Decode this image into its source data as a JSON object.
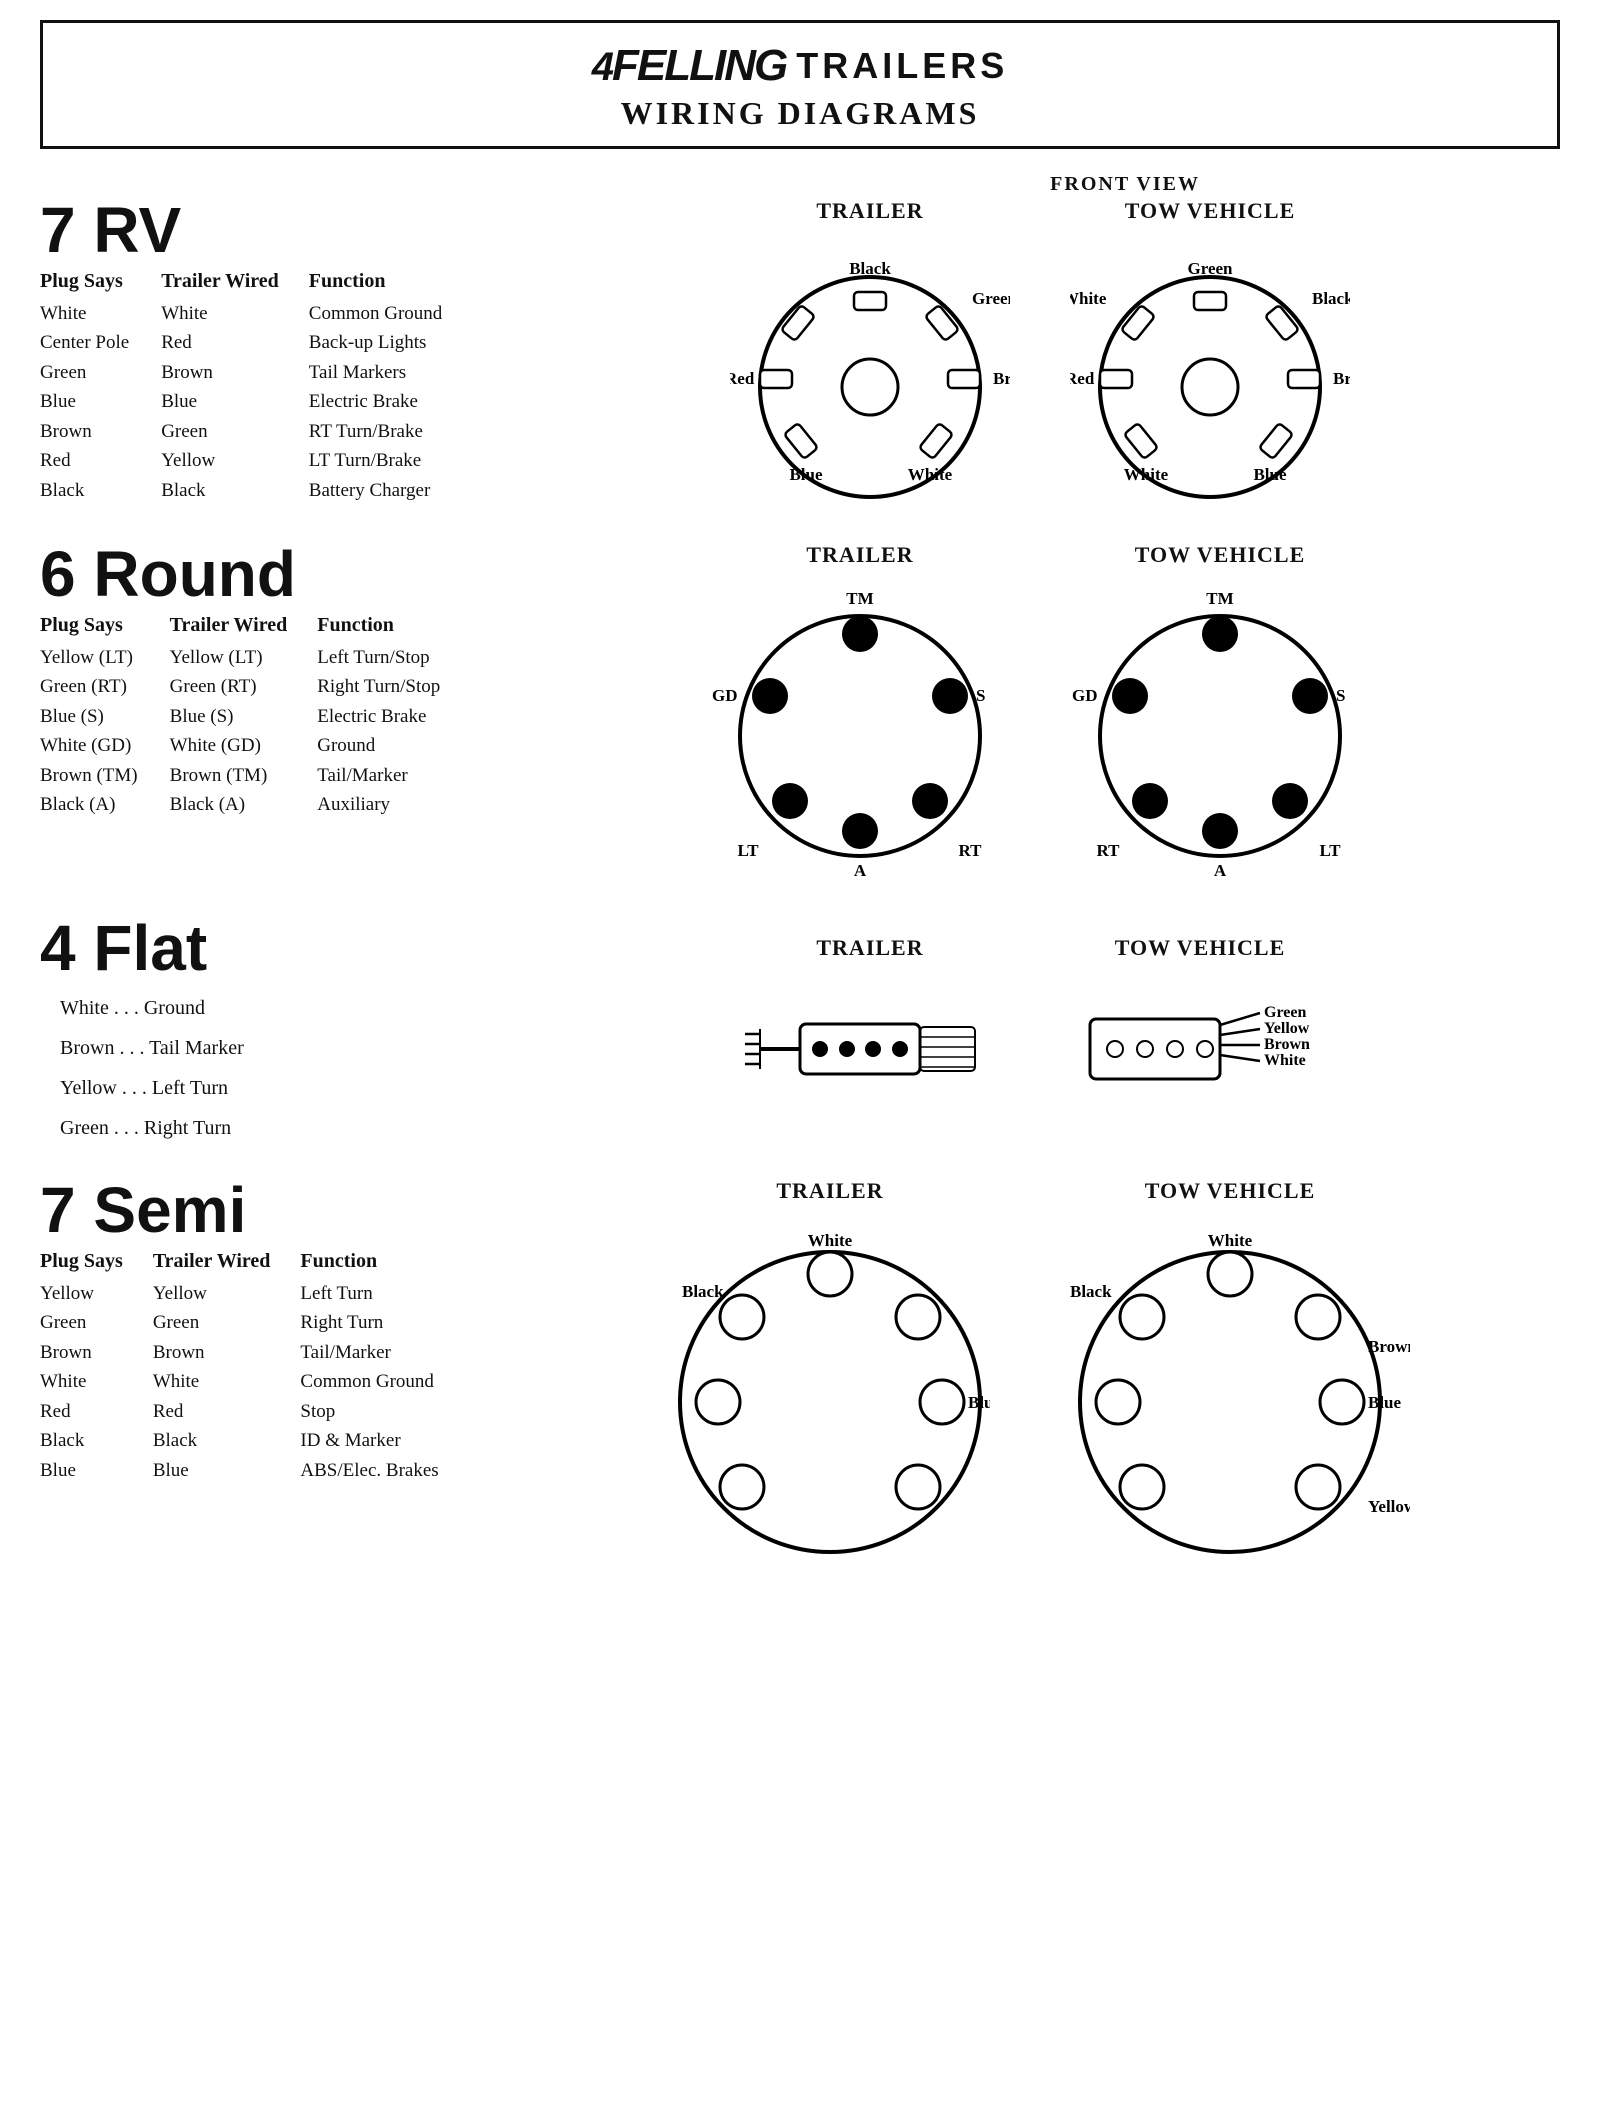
{
  "header": {
    "brand": "FELLING",
    "title_line1": "TRAILERS",
    "title_line2": "WIRING DIAGRAMS"
  },
  "front_view_label": "FRONT VIEW",
  "sections": {
    "rv7": {
      "title": "7 RV",
      "col1": "Plug Says",
      "col2": "Trailer Wired",
      "col3": "Function",
      "rows": [
        [
          "White",
          "White",
          "Common Ground"
        ],
        [
          "Center Pole",
          "Red",
          "Back-up Lights"
        ],
        [
          "Green",
          "Brown",
          "Tail Markers"
        ],
        [
          "Blue",
          "Blue",
          "Electric Brake"
        ],
        [
          "Brown",
          "Green",
          "RT Turn/Brake"
        ],
        [
          "Red",
          "Yellow",
          "LT Turn/Brake"
        ],
        [
          "Black",
          "Black",
          "Battery Charger"
        ]
      ],
      "trailer_label": "TRAILER",
      "tow_label": "TOW VEHICLE"
    },
    "round6": {
      "title": "6 Round",
      "col1": "Plug Says",
      "col2": "Trailer Wired",
      "col3": "Function",
      "rows": [
        [
          "Yellow (LT)",
          "Yellow (LT)",
          "Left Turn/Stop"
        ],
        [
          "Green (RT)",
          "Green (RT)",
          "Right Turn/Stop"
        ],
        [
          "Blue (S)",
          "Blue (S)",
          "Electric Brake"
        ],
        [
          "White (GD)",
          "White (GD)",
          "Ground"
        ],
        [
          "Brown (TM)",
          "Brown (TM)",
          "Tail/Marker"
        ],
        [
          "Black (A)",
          "Black (A)",
          "Auxiliary"
        ]
      ],
      "trailer_label": "TRAILER",
      "tow_label": "TOW VEHICLE"
    },
    "flat4": {
      "title": "4 Flat",
      "items": [
        [
          "White",
          "Ground"
        ],
        [
          "Brown",
          "Tail Marker"
        ],
        [
          "Yellow",
          "Left Turn"
        ],
        [
          "Green",
          "Right Turn"
        ]
      ],
      "trailer_label": "TRAILER",
      "tow_label": "TOW VEHICLE"
    },
    "semi7": {
      "title": "7 Semi",
      "col1": "Plug Says",
      "col2": "Trailer Wired",
      "col3": "Function",
      "rows": [
        [
          "Yellow",
          "Yellow",
          "Left Turn"
        ],
        [
          "Green",
          "Green",
          "Right Turn"
        ],
        [
          "Brown",
          "Brown",
          "Tail/Marker"
        ],
        [
          "White",
          "White",
          "Common Ground"
        ],
        [
          "Red",
          "Red",
          "Stop"
        ],
        [
          "Black",
          "Black",
          "ID & Marker"
        ],
        [
          "Blue",
          "Blue",
          "ABS/Elec. Brakes"
        ]
      ],
      "trailer_label": "TRAILER",
      "tow_label": "TOW VEHICLE"
    }
  }
}
